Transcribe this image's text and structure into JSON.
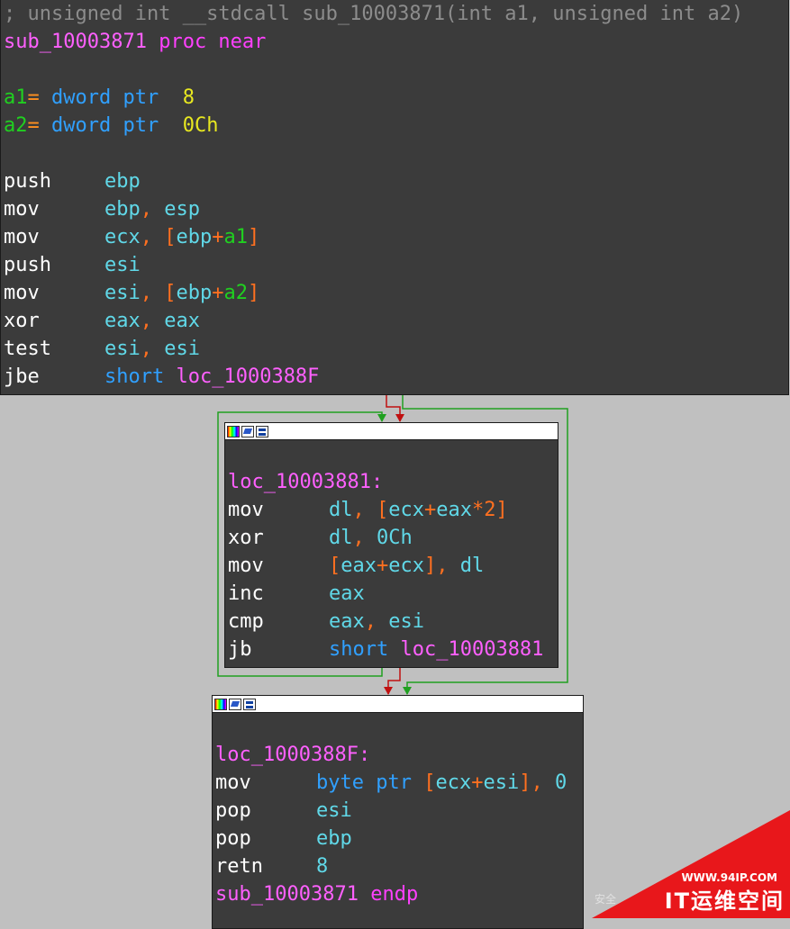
{
  "block1": {
    "comment": "; unsigned int __stdcall sub_10003871(int a1, unsigned int a2)",
    "proc_name": "sub_10003871",
    "proc_kw": "proc near",
    "args": [
      {
        "name": "a1",
        "eq": "=",
        "type": "dword ptr",
        "value": "8"
      },
      {
        "name": "a2",
        "eq": "=",
        "type": "dword ptr",
        "value": "0Ch"
      }
    ],
    "instructions": [
      {
        "mnem": "push",
        "op1": "ebp"
      },
      {
        "mnem": "mov",
        "op1": "ebp",
        "comma": ",",
        "op2": "esp"
      },
      {
        "mnem": "mov",
        "op1": "ecx",
        "comma": ",",
        "lb": "[",
        "base": "ebp",
        "plus": "+",
        "var": "a1",
        "rb": "]"
      },
      {
        "mnem": "push",
        "op1": "esi"
      },
      {
        "mnem": "mov",
        "op1": "esi",
        "comma": ",",
        "lb": "[",
        "base": "ebp",
        "plus": "+",
        "var": "a2",
        "rb": "]"
      },
      {
        "mnem": "xor",
        "op1": "eax",
        "comma": ",",
        "op2": "eax"
      },
      {
        "mnem": "test",
        "op1": "esi",
        "comma": ",",
        "op2": "esi"
      },
      {
        "mnem": "jbe",
        "type": "short",
        "target": "loc_1000388F"
      }
    ]
  },
  "block2": {
    "label": "loc_10003881:",
    "i1": {
      "mnem": "mov",
      "op1": "dl",
      "comma": ",",
      "lb": "[",
      "a": "ecx",
      "plus": "+",
      "b": "eax",
      "mul": "*",
      "n": "2",
      "rb": "]"
    },
    "i2": {
      "mnem": "xor",
      "op1": "dl",
      "comma": ",",
      "imm": "0Ch"
    },
    "i3": {
      "mnem": "mov",
      "lb": "[",
      "a": "eax",
      "plus": "+",
      "b": "ecx",
      "rb": "]",
      "comma": ",",
      "op2": "dl"
    },
    "i4": {
      "mnem": "inc",
      "op1": "eax"
    },
    "i5": {
      "mnem": "cmp",
      "op1": "eax",
      "comma": ",",
      "op2": "esi"
    },
    "i6": {
      "mnem": "jb",
      "type": "short",
      "target": "loc_10003881"
    }
  },
  "block3": {
    "label": "loc_1000388F:",
    "i1": {
      "mnem": "mov",
      "type": "byte ptr",
      "lb": "[",
      "a": "ecx",
      "plus": "+",
      "b": "esi",
      "rb": "]",
      "comma": ",",
      "imm": "0"
    },
    "i2": {
      "mnem": "pop",
      "op1": "esi"
    },
    "i3": {
      "mnem": "pop",
      "op1": "ebp"
    },
    "i4": {
      "mnem": "retn",
      "imm": "8"
    },
    "endp_name": "sub_10003871",
    "endp_kw": "endp"
  },
  "watermark": {
    "url": "WWW.94IP.COM",
    "name": "IT运维空间",
    "small": "安全"
  },
  "colors": {
    "background": "#c0c0c0",
    "block_bg": "#3b3b3b",
    "edge_true": "#20a020",
    "edge_false": "#c01010"
  }
}
